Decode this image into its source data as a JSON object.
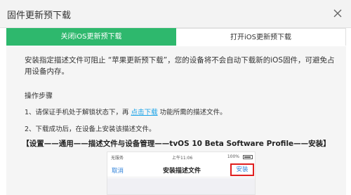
{
  "window": {
    "title": "固件更新预下载"
  },
  "tabs": [
    {
      "label": "关闭iOS更新预下载"
    },
    {
      "label": "打开iOS更新预下载"
    }
  ],
  "content": {
    "intro": "安装指定描述文件可阻止 “苹果更新预下载”，您的设备将不会自动下载新的iOS固件，可避免占用设备内存。",
    "steps_heading": "操作步骤",
    "step1_prefix": "1、请保证手机处于解锁状态下，再 ",
    "step1_link": "点击下载",
    "step1_suffix": " 功能所需的描述文件。",
    "step2": "2、下载成功后，在设备上安装该描述文件。",
    "path": "【设置——通用——描述文件与设备管理——tvOS 10 Beta Software Profile——安装】"
  },
  "phone": {
    "carrier": "无服务",
    "time": "上午11:06",
    "battery": "100%",
    "cancel_label": "取消",
    "nav_title": "安装描述文件",
    "install_label": "安装"
  },
  "colors": {
    "accent": "#2eb86d",
    "link": "#1aa3e8",
    "highlight": "#e01f1f"
  }
}
